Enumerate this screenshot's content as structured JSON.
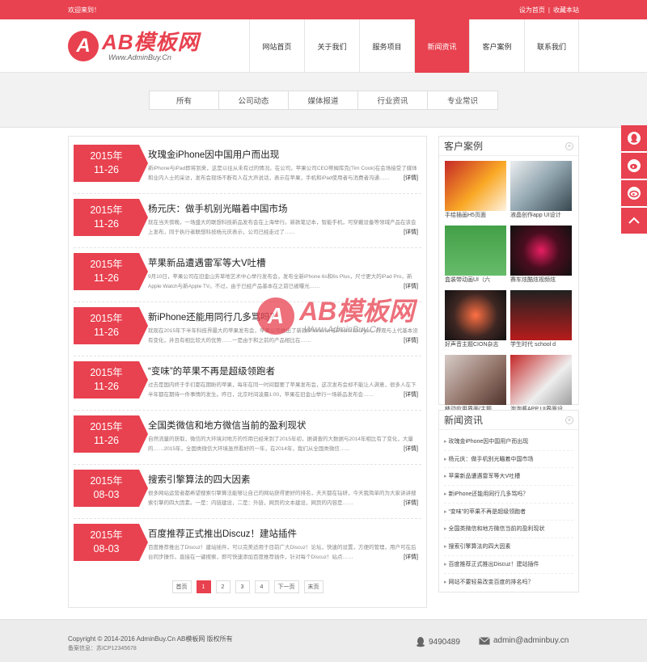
{
  "topbar": {
    "welcome": "欢迎来到！",
    "set_home": "设为首页",
    "separator": "|",
    "bookmark": "收藏本站"
  },
  "logo": {
    "main": "AB模板网",
    "sub": "Www.AdminBuy.Cn",
    "mark": "A"
  },
  "nav": [
    {
      "label": "网站首页",
      "active": false
    },
    {
      "label": "关于我们",
      "active": false
    },
    {
      "label": "服务项目",
      "active": false
    },
    {
      "label": "新闻资讯",
      "active": true
    },
    {
      "label": "客户案例",
      "active": false
    },
    {
      "label": "联系我们",
      "active": false
    }
  ],
  "categories": [
    "所有",
    "公司动态",
    "媒体报道",
    "行业资讯",
    "专业常识"
  ],
  "articles": [
    {
      "year": "2015年",
      "md": "11-26",
      "title": "玫瑰金iPhone因中国用户而出现",
      "summary": "新iPhone与iPad即将到来，这是以往从未有过的情况。在公司，苹果公司CEO蒂姆库克(Tim Cook)在会场接受了媒体和业内人士的采访，发布会现场不断有人在大声说话，表示在苹果，手机和iPad使用者与消费者沟通……",
      "more": "[详情]"
    },
    {
      "year": "2015年",
      "md": "11-26",
      "title": "杨元庆：做手机别光瞄着中国市场",
      "summary": "就在当天傍晚，一场盛大的联想科技新品发布会在上海举行。新款笔记本，智能手机，可穿戴设备等领域产品在该会上发布，同于执行者联想科技杨元庆表示，公司已经走过了……",
      "more": "[详情]"
    },
    {
      "year": "2015年",
      "md": "11-26",
      "title": "苹果新品遭遇雷军等大V吐槽",
      "summary": "9月10日，苹果公司在旧金山芳草地艺术中心举行发布会，发布全新iPhone 6s和6s Plus，尺寸更大的iPad Pro，新Apple Watch与新Apple TV。不过，由于已经产品基本在之前已被曝光……",
      "more": "[详情]"
    },
    {
      "year": "2015年",
      "md": "11-26",
      "title": "新iPhone还能用同行几多骂吗？",
      "summary": "就现在2015年下半年科技界最大的苹果发布会，苹果公司推出了新款iPhone 6s与iPhone 6s Plus，外观与上代基本没有变化，并且有相比较大的优势……一是由于和之前的产品相比在……",
      "more": "[详情]"
    },
    {
      "year": "2015年",
      "md": "11-26",
      "title": "“变味”的苹果不再是超级领跑者",
      "summary": "过去是国内终于手们都在期盼的苹果，每年在同一时间都要了苹果发布会，这次发布会却不能让人满意，很多人在下半年都在期待一件事情的发生。昨日，北京时间凌晨1:00，苹果在旧金山举行一场新品发布会……",
      "more": "[详情]"
    },
    {
      "year": "2015年",
      "md": "11-26",
      "title": "全国类微信和地方微信当前的盈利现状",
      "summary": "自然流量的获取，微信的大环境对地方的作用已经来到了2015年初，据调查的大数据与2014年相比有了变化，大量的……2015年，全国类微信大环境虽然看好的一年，在2014年，我们从全国类微信……",
      "more": "[详情]"
    },
    {
      "year": "2015年",
      "md": "08-03",
      "title": "搜索引擎算法的四大因素",
      "summary": "很多网站运营者都希望搜索引擎算法能够让自己的网站获得更好的排名，天天都在钻研，今天我简单的为大家讲讲搜索引擎的四大因素。一是：内链建设，二是：外链，网页的文本建设，网页的内容是……",
      "more": "[详情]"
    },
    {
      "year": "2015年",
      "md": "08-03",
      "title": "百度推荐正式推出Discuz！建站插件",
      "summary": "百度推荐推出了Discuz！建站插件，可以完美适用于目前广大Discuz！论坛，快速的设置，方便的管理，用户可在后台同步操作，直接在一键搜索，即可快速添加百度推荐插件，针对每个Discuz！站点……",
      "more": "[详情]"
    }
  ],
  "pager": [
    "首页",
    "1",
    "2",
    "3",
    "4",
    "下一页",
    "末页"
  ],
  "pager_current": "1",
  "sidebar": {
    "cases_title": "客户案例",
    "cases": [
      {
        "caption": "手绘插画H5页面"
      },
      {
        "caption": "液晶创作app UI设计"
      },
      {
        "caption": "盒装带动画UI（六"
      },
      {
        "caption": "赛车炫酷炫视频炫"
      },
      {
        "caption": "好声音主题CION杂志"
      },
      {
        "caption": "学生时代 school d"
      },
      {
        "caption": "移动应用界面/主题"
      },
      {
        "caption": "泡泡酱APP UI界面设"
      }
    ],
    "news_title": "新闻资讯",
    "news": [
      "玫瑰金iPhone因中国用户而出现",
      "杨元庆：做手机别光瞄着中国市场",
      "苹果新品遭遇雷军等大V吐槽",
      "新iPhone还能用同行几多骂吗？",
      "“变味”的苹果不再是超级领跑者",
      "全国类微信和地方微信当前的盈利现状",
      "搜索引擎算法的四大因素",
      "百度推荐正式推出Discuz！建站插件",
      "网站不要轻易改变百度的排名吗？"
    ],
    "more_glyph": "+"
  },
  "footer": {
    "copyright": "Copyright © 2014-2016 AdminBuy.Cn AB模板网 版权所有",
    "icp": "备案信息：苏ICP12345678",
    "qq": "9490489",
    "email": "admin@adminbuy.cn"
  },
  "watermark": {
    "main": "AB模板网",
    "sub": "Www.AdminBuy.Cn"
  },
  "colors": {
    "accent": "#e8414f"
  },
  "icons": [
    "qq-icon",
    "weibo-icon",
    "weibo-alt-icon",
    "back-to-top-icon",
    "qq-footer-icon",
    "mail-icon"
  ]
}
